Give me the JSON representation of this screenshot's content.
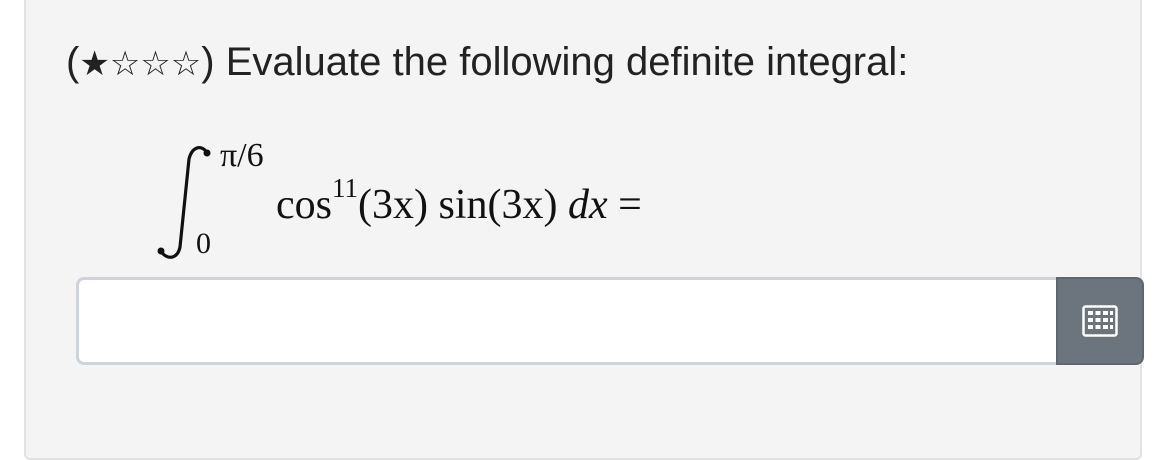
{
  "question": {
    "open_paren": "(",
    "stars": [
      "★",
      "☆",
      "☆",
      "☆"
    ],
    "close_paren": ")",
    "text": "Evaluate the following definite integral:",
    "difficulty_filled": 1,
    "difficulty_total": 4
  },
  "integral": {
    "upper_limit": "π/6",
    "lower_limit": "0",
    "func1": "cos",
    "exponent": "11",
    "arg1": "(3x)",
    "func2": "sin",
    "arg2": "(3x)",
    "differential": "dx",
    "equals": "="
  },
  "answer": {
    "value": "",
    "placeholder": ""
  },
  "keypad_button": {
    "icon": "keypad-icon",
    "color": "#6c757d"
  }
}
